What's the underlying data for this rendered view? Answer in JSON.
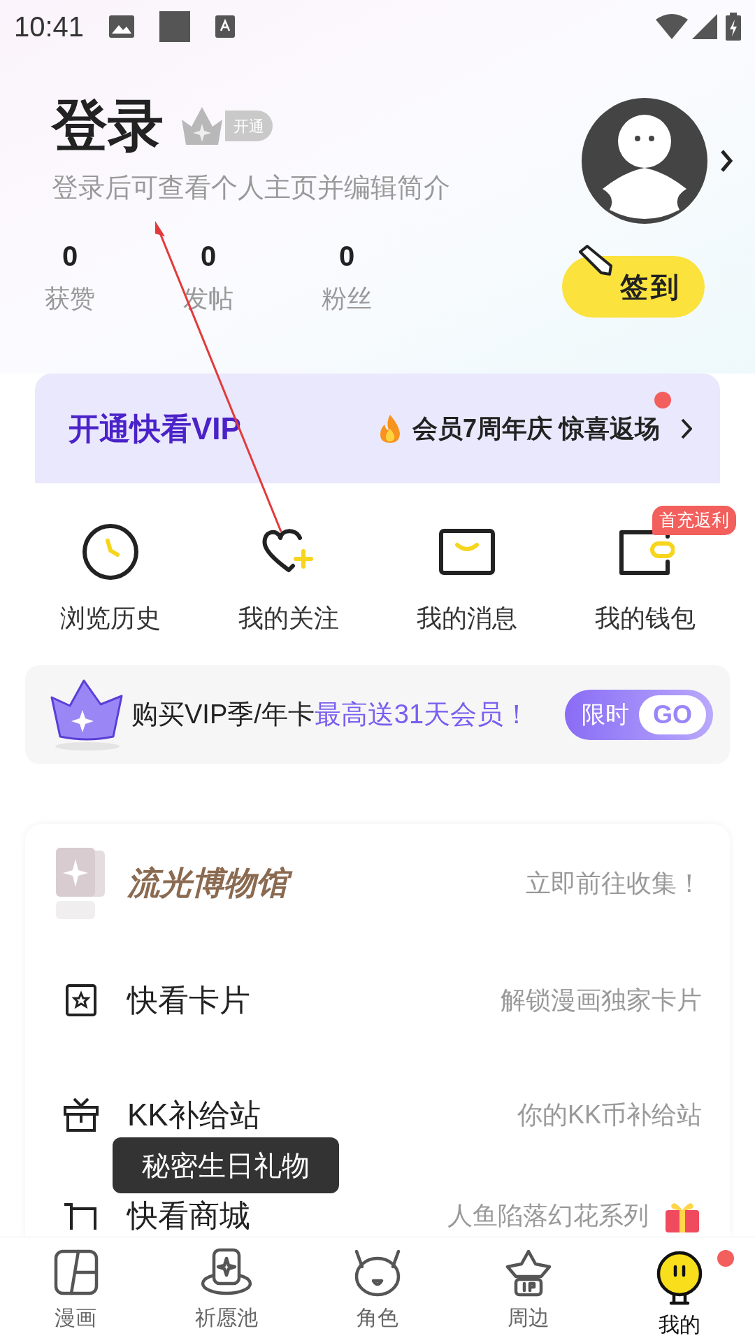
{
  "status_bar": {
    "time": "10:41"
  },
  "profile": {
    "title": "登录",
    "badge": "开通",
    "subtitle": "登录后可查看个人主页并编辑简介",
    "stats": [
      {
        "value": "0",
        "label": "获赞"
      },
      {
        "value": "0",
        "label": "发帖"
      },
      {
        "value": "0",
        "label": "粉丝"
      }
    ],
    "checkin": "签到"
  },
  "vip_banner": {
    "title": "开通快看VIP",
    "promo": "会员7周年庆 惊喜返场"
  },
  "shortcuts": [
    {
      "kind": "history",
      "label": "浏览历史"
    },
    {
      "kind": "follow",
      "label": "我的关注"
    },
    {
      "kind": "messages",
      "label": "我的消息"
    },
    {
      "kind": "wallet",
      "label": "我的钱包",
      "badge": "首充返利"
    }
  ],
  "promo_card": {
    "segments": [
      {
        "text": "购买VIP季/年卡",
        "highlight": false
      },
      {
        "text": "最高送",
        "highlight": true
      },
      {
        "text": "31天会员！",
        "highlight": true
      }
    ],
    "tag": "限时",
    "button": "GO"
  },
  "menu": [
    {
      "kind": "museum",
      "label": "流光博物馆",
      "hint": "立即前往收集！"
    },
    {
      "kind": "cards",
      "label": "快看卡片",
      "hint": "解锁漫画独家卡片"
    },
    {
      "kind": "supply",
      "label": "KK补给站",
      "hint": "你的KK币补给站"
    },
    {
      "kind": "mall",
      "label": "快看商城",
      "hint": "人鱼陷落幻花系列"
    }
  ],
  "tooltip": "秘密生日礼物",
  "tab_bar": [
    {
      "kind": "comics",
      "label": "漫画",
      "selected": false
    },
    {
      "kind": "wish",
      "label": "祈愿池",
      "selected": false
    },
    {
      "kind": "role",
      "label": "角色",
      "selected": false
    },
    {
      "kind": "merch",
      "label": "周边",
      "selected": false
    },
    {
      "kind": "me",
      "label": "我的",
      "selected": true
    }
  ]
}
